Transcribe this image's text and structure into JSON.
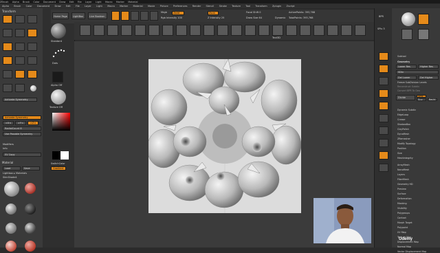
{
  "app": {
    "title_bar": "ZBrush",
    "menu_top": [
      "Alpha",
      "Brush",
      "Color",
      "Document",
      "Draw",
      "Edit",
      "File",
      "Layer",
      "Light",
      "Macro",
      "Marker",
      "Material",
      "Movie",
      "Picture",
      "Preferences",
      "Render",
      "Stencil",
      "Stroke",
      "Texture",
      "Tool",
      "Transform",
      "Zplugin",
      "Zscript",
      "Help"
    ],
    "menu_second": [
      "Alpha",
      "Brush",
      "Color",
      "Document",
      "Draw",
      "Edit",
      "File",
      "Layer",
      "Light",
      "Macro",
      "Marker",
      "Material",
      "Movie",
      "Picture",
      "Preferences",
      "Render",
      "Stencil",
      "Stroke",
      "Texture",
      "Tool",
      "Transform",
      "Zplugin",
      "Zscript"
    ]
  },
  "toolbar": {
    "home_page": "Home Page",
    "lightbox": "LightBox",
    "live_boolean": "Live Boolean",
    "edit": "Edit",
    "draw": "Draw",
    "move": "Move",
    "scale": "Scale",
    "rotate": "Rotate",
    "mrgb": "Mrgb",
    "rgb": "Rgb",
    "m": "M",
    "zadd": "Zadd",
    "zsub": "Zsub",
    "zcut": "Zcut",
    "rgb_intensity": "Rgb Intensity 100",
    "z_intensity": "Z Intensity 25",
    "focal_shift": "Focal Shift 0",
    "draw_size": "Draw Size 64",
    "dynamic": "Dynamic",
    "active_points": "ActivePoints: 393,768",
    "total_points": "TotalPoints: 393,768"
  },
  "shelf": {
    "brushes_label": "Brushes",
    "text_label": "Text3D"
  },
  "left_panel": {
    "header": "Transform",
    "mirror": "Mirror",
    "symmetry_label": "Activate Symmetry",
    "sym_x": ">X<",
    "sym_y": ">Y<",
    "sym_z": ">Z<",
    "radial": "(R)",
    "radial_count": "RadialCount 8",
    "use_posable": "Use Posable Symmetry",
    "modifiers": "Modifiers",
    "info": "Info",
    "sv_copy": "SV Copy",
    "material_header": "Material",
    "material_load": "Load",
    "material_save": "Save",
    "lightbox_materials": "Lightbox ▸ Materials",
    "skin_shade": "SkinShade4",
    "materials": [
      "SkinShade4",
      "MatCap Red Wax",
      "BasicMaterial",
      "ReflectedMap",
      "MatCap Gray",
      "SphereEnvironment",
      "NormalRGBMat",
      "MatCapWhite",
      "Toyplastic",
      "BlueMetal"
    ],
    "brush_names": [
      "Standard",
      "Dots",
      "Alpha Off",
      "Texture Off"
    ],
    "switch_color": "SwitchColor",
    "gradient": "Gradient"
  },
  "right_panel": {
    "subtool": "Subtool",
    "geometry": "Geometry",
    "lower_res": "Lower Res",
    "higher_res": "Higher Res",
    "sdiv": "SDiv",
    "del_lower": "Del Lower",
    "del_higher": "Del Higher",
    "freeze_subdivision": "Freeze SubDivision Levels",
    "reconstruct": "Reconstruct Subdiv",
    "convert_bpr": "Convert BPR To Geo",
    "divide": "Divide",
    "smt": "Smt",
    "suv": "Suv",
    "reuv": "ReUV",
    "items": [
      "Dynamic Subdiv",
      "EdgeLoop",
      "Crease",
      "ShadowBox",
      "ClayPolish",
      "DynaMesh",
      "ZRemesher",
      "Modify Topology",
      "Position",
      "Size",
      "MeshIntegrity",
      "ArrayMesh",
      "NanoMesh",
      "Layers",
      "FiberMesh",
      "Geometry HD",
      "Preview",
      "Surface",
      "Deformation",
      "Masking",
      "Visibility",
      "Polygroups",
      "Contact",
      "Morph Target",
      "Polypaint",
      "UV Map",
      "Texture Map",
      "Displacement Map",
      "Normal Map",
      "Vector Displacement Map"
    ]
  },
  "right_strip": {
    "labels": [
      "BPR",
      "SPix 3",
      "Scroll",
      "Zoom",
      "Actual",
      "AAHalf",
      "Persp",
      "Floor",
      "Local",
      "Frame",
      "Move",
      "Scale",
      "Rotate",
      "Transp",
      "Solo",
      "Xpose"
    ]
  },
  "watermark": "Udemy"
}
